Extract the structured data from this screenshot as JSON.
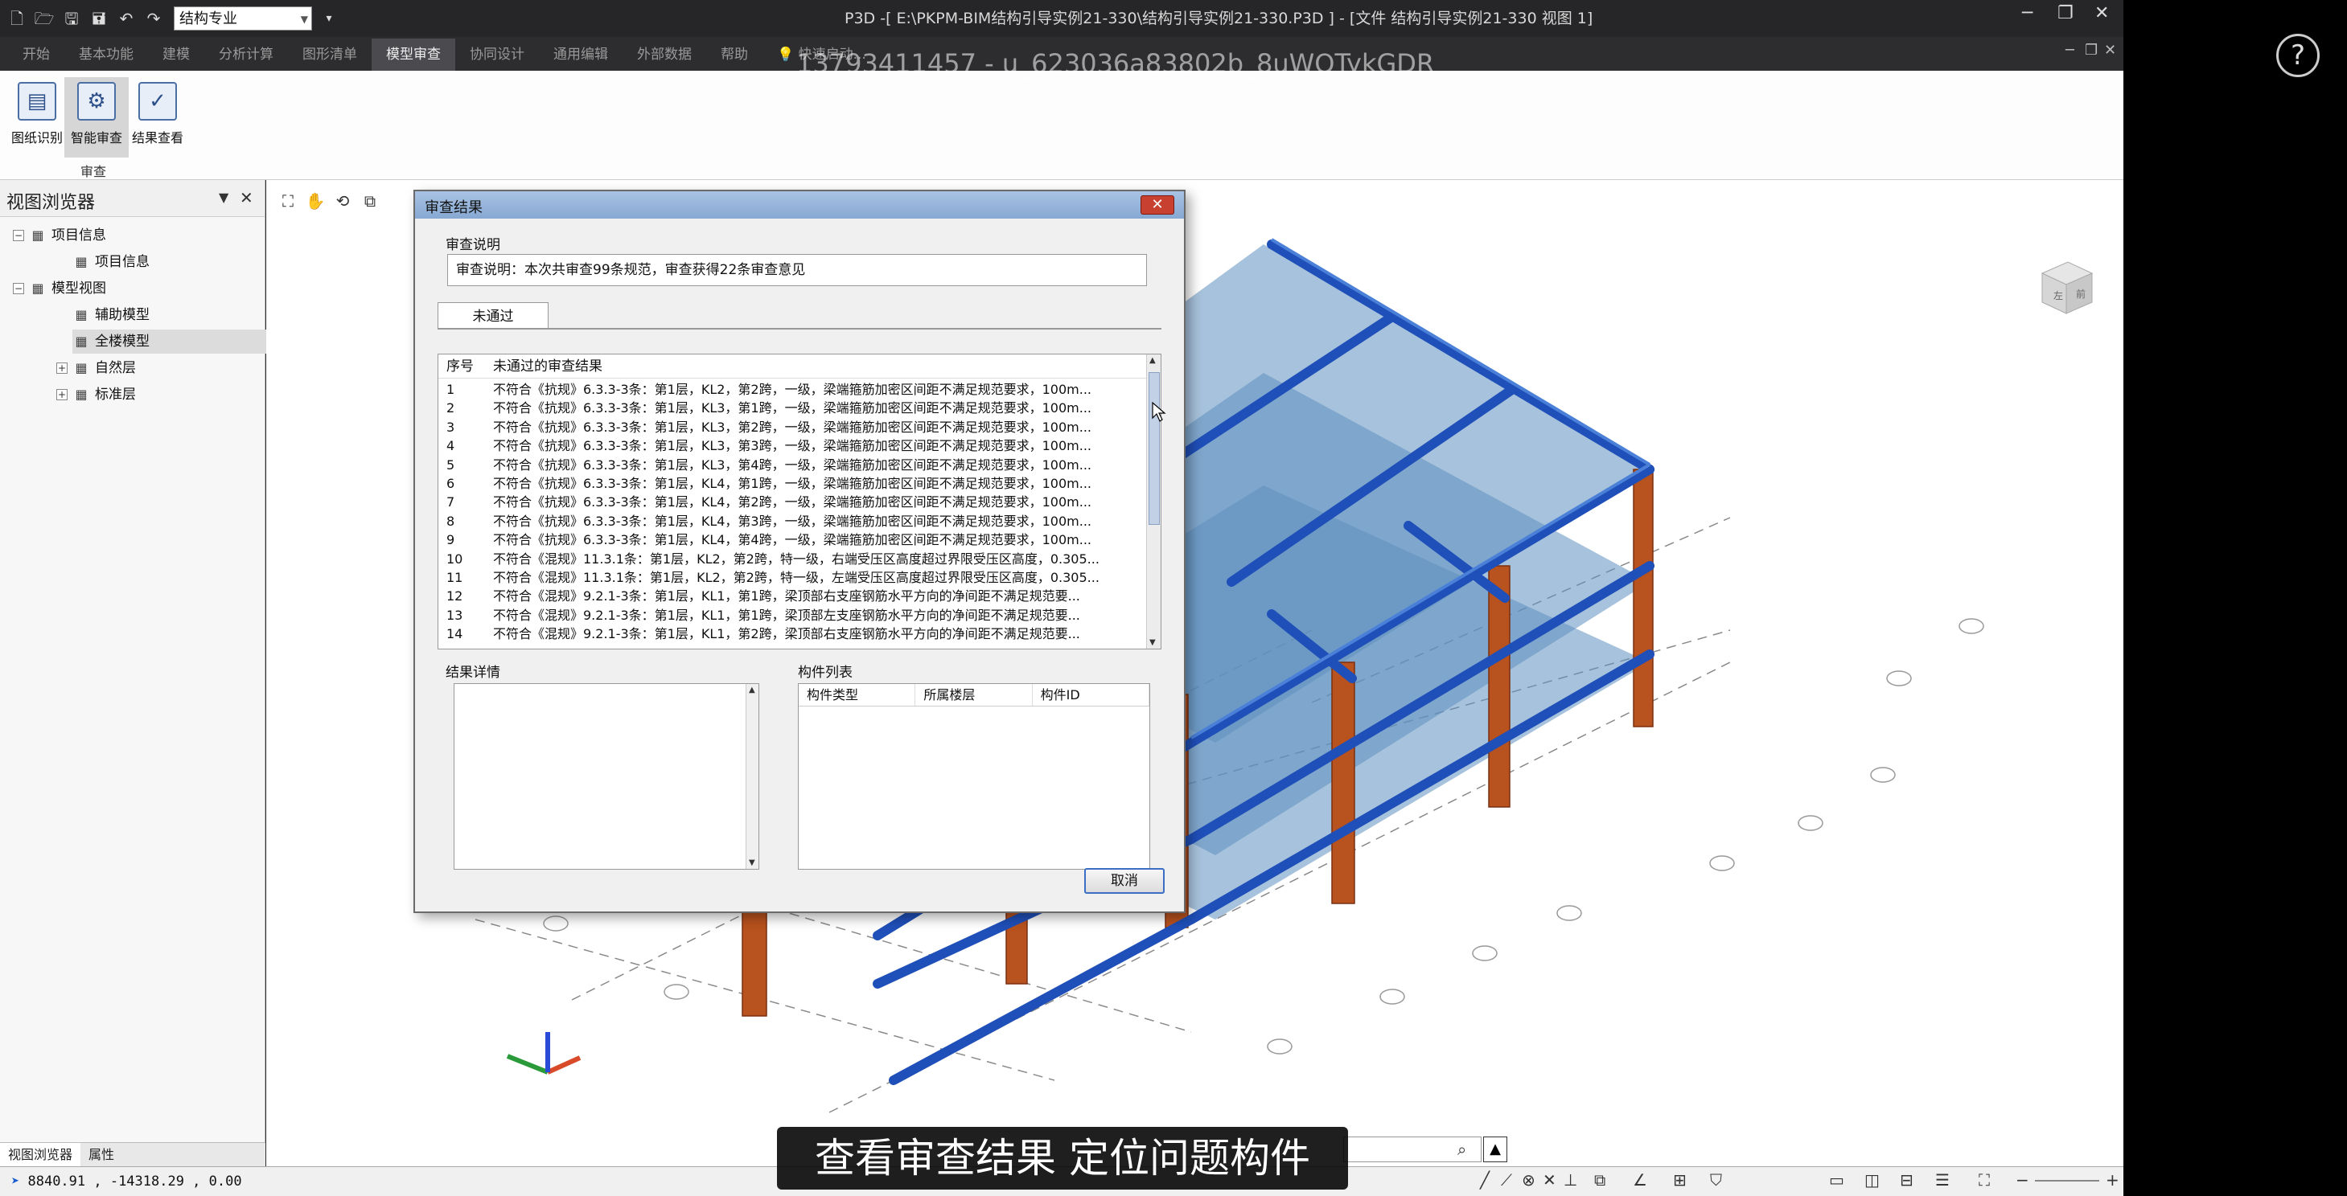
{
  "titlebar": {
    "profession_select": "结构专业",
    "title": "P3D -[ E:\\PKPM-BIM结构引导实例21-330\\结构引导实例21-330.P3D ] - [文件 结构引导实例21-330 视图 1]",
    "quick_icons": [
      "new-file-icon",
      "open-folder-icon",
      "save-icon",
      "save-all-icon",
      "undo-icon",
      "redo-icon"
    ]
  },
  "ribbon": {
    "tabs": [
      "开始",
      "基本功能",
      "建模",
      "分析计算",
      "图形清单",
      "模型审查",
      "协同设计",
      "通用编辑",
      "外部数据",
      "帮助",
      "快速启动..."
    ],
    "active_tab": "模型审查",
    "buttons": [
      {
        "label": "图纸识别",
        "icon": "drawing-recognition-icon"
      },
      {
        "label": "智能审查",
        "icon": "smart-review-icon"
      },
      {
        "label": "结果查看",
        "icon": "result-view-icon"
      }
    ],
    "group_label": "审查"
  },
  "watermark": "13793411457 - u_623036a83802b_8uWQTykGDR",
  "left_panel": {
    "title": "视图浏览器",
    "tree": [
      {
        "label": "项目信息",
        "level": 0,
        "toggle": "⊟",
        "icon": "project-info-icon"
      },
      {
        "label": "项目信息",
        "level": 1,
        "toggle": "",
        "icon": "document-icon"
      },
      {
        "label": "模型视图",
        "level": 0,
        "toggle": "⊟",
        "icon": "model-view-icon"
      },
      {
        "label": "辅助模型",
        "level": 1,
        "toggle": "",
        "icon": "model-icon"
      },
      {
        "label": "全楼模型",
        "level": 1,
        "toggle": "",
        "icon": "full-model-icon"
      },
      {
        "label": "自然层",
        "level": 1,
        "toggle": "⊞",
        "icon": "natural-floor-icon"
      },
      {
        "label": "标准层",
        "level": 1,
        "toggle": "⊞",
        "icon": "standard-floor-icon"
      }
    ],
    "bottom_tabs": [
      "视图浏览器",
      "属性"
    ]
  },
  "dialog": {
    "title": "审查结果",
    "desc_group_label": "审查说明",
    "desc_text": "审查说明：本次共审查99条规范，审查获得22条审查意见",
    "tab_label": "未通过",
    "list_headers": [
      "序号",
      "未通过的审查结果"
    ],
    "rows": [
      {
        "no": "1",
        "text": "不符合《抗规》6.3.3-3条：第1层，KL2，第2跨，一级，梁端箍筋加密区间距不满足规范要求，100m..."
      },
      {
        "no": "2",
        "text": "不符合《抗规》6.3.3-3条：第1层，KL3，第1跨，一级，梁端箍筋加密区间距不满足规范要求，100m..."
      },
      {
        "no": "3",
        "text": "不符合《抗规》6.3.3-3条：第1层，KL3，第2跨，一级，梁端箍筋加密区间距不满足规范要求，100m..."
      },
      {
        "no": "4",
        "text": "不符合《抗规》6.3.3-3条：第1层，KL3，第3跨，一级，梁端箍筋加密区间距不满足规范要求，100m..."
      },
      {
        "no": "5",
        "text": "不符合《抗规》6.3.3-3条：第1层，KL3，第4跨，一级，梁端箍筋加密区间距不满足规范要求，100m..."
      },
      {
        "no": "6",
        "text": "不符合《抗规》6.3.3-3条：第1层，KL4，第1跨，一级，梁端箍筋加密区间距不满足规范要求，100m..."
      },
      {
        "no": "7",
        "text": "不符合《抗规》6.3.3-3条：第1层，KL4，第2跨，一级，梁端箍筋加密区间距不满足规范要求，100m..."
      },
      {
        "no": "8",
        "text": "不符合《抗规》6.3.3-3条：第1层，KL4，第3跨，一级，梁端箍筋加密区间距不满足规范要求，100m..."
      },
      {
        "no": "9",
        "text": "不符合《抗规》6.3.3-3条：第1层，KL4，第4跨，一级，梁端箍筋加密区间距不满足规范要求，100m..."
      },
      {
        "no": "10",
        "text": "不符合《混规》11.3.1条：第1层，KL2，第2跨，特一级，右端受压区高度超过界限受压区高度，0.305..."
      },
      {
        "no": "11",
        "text": "不符合《混规》11.3.1条：第1层，KL2，第2跨，特一级，左端受压区高度超过界限受压区高度，0.305..."
      },
      {
        "no": "12",
        "text": "不符合《混规》9.2.1-3条：第1层，KL1，第1跨，梁顶部右支座钢筋水平方向的净间距不满足规范要..."
      },
      {
        "no": "13",
        "text": "不符合《混规》9.2.1-3条：第1层，KL1，第1跨，梁顶部左支座钢筋水平方向的净间距不满足规范要..."
      },
      {
        "no": "14",
        "text": "不符合《混规》9.2.1-3条：第1层，KL1，第2跨，梁顶部右支座钢筋水平方向的净间距不满足规范要..."
      }
    ],
    "detail_label": "结果详情",
    "component_label": "构件列表",
    "component_headers": [
      "构件类型",
      "所属楼层",
      "构件ID"
    ],
    "cancel_label": "取消"
  },
  "status": {
    "coords": "8840.91 , -14318.29 , 0.00"
  },
  "subtitle": "查看审查结果  定位问题构件",
  "help_label": "?",
  "view_cube_label": "左 前",
  "colors": {
    "beam": "#1f4fb8",
    "column": "#b8521e",
    "slab": "#5f8fbf",
    "ribbon_active": "#4a4a4f",
    "dialog_title": "#9db8dd"
  }
}
